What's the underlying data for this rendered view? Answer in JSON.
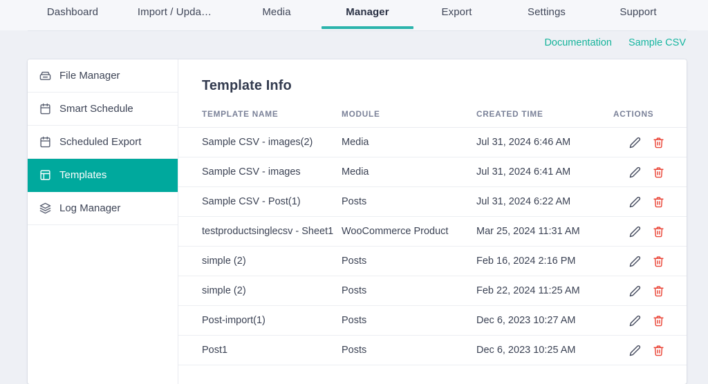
{
  "topnav": {
    "tabs": [
      {
        "label": "Dashboard",
        "active": false
      },
      {
        "label": "Import / Upda…",
        "active": false
      },
      {
        "label": "Media",
        "active": false
      },
      {
        "label": "Manager",
        "active": true
      },
      {
        "label": "Export",
        "active": false
      },
      {
        "label": "Settings",
        "active": false
      },
      {
        "label": "Support",
        "active": false
      }
    ],
    "accent_color": "#2cb4ac"
  },
  "sublinks": [
    {
      "label": "Documentation",
      "icon": "documentation-link"
    },
    {
      "label": "Sample CSV",
      "icon": "sample-csv-link"
    }
  ],
  "sidebar": {
    "items": [
      {
        "label": "File Manager",
        "icon": "drive-icon",
        "active": false
      },
      {
        "label": "Smart Schedule",
        "icon": "calendar-icon",
        "active": false
      },
      {
        "label": "Scheduled Export",
        "icon": "calendar-icon",
        "active": false
      },
      {
        "label": "Templates",
        "icon": "layout-icon",
        "active": true
      },
      {
        "label": "Log Manager",
        "icon": "layers-icon",
        "active": false
      }
    ],
    "active_color": "#00a99d"
  },
  "main": {
    "title": "Template Info",
    "table": {
      "columns": [
        "TEMPLATE NAME",
        "MODULE",
        "CREATED TIME",
        "ACTIONS"
      ],
      "rows": [
        {
          "name": "Sample CSV - images(2)",
          "module": "Media",
          "created": "Jul 31, 2024 6:46 AM"
        },
        {
          "name": "Sample CSV - images",
          "module": "Media",
          "created": "Jul 31, 2024 6:41 AM"
        },
        {
          "name": "Sample CSV - Post(1)",
          "module": "Posts",
          "created": "Jul 31, 2024 6:22 AM"
        },
        {
          "name": "testproductsinglecsv - Sheet1",
          "module": "WooCommerce Product",
          "created": "Mar 25, 2024 11:31 AM"
        },
        {
          "name": "simple (2)",
          "module": "Posts",
          "created": "Feb 16, 2024 2:16 PM"
        },
        {
          "name": "simple (2)",
          "module": "Posts",
          "created": "Feb 22, 2024 11:25 AM"
        },
        {
          "name": "Post-import(1)",
          "module": "Posts",
          "created": "Dec 6, 2023 10:27 AM"
        },
        {
          "name": "Post1",
          "module": "Posts",
          "created": "Dec 6, 2023 10:25 AM"
        }
      ],
      "row_actions": [
        {
          "icon": "edit-pencil-icon",
          "color": "#454b5e"
        },
        {
          "icon": "trash-icon",
          "color": "#ea4335"
        }
      ]
    }
  }
}
